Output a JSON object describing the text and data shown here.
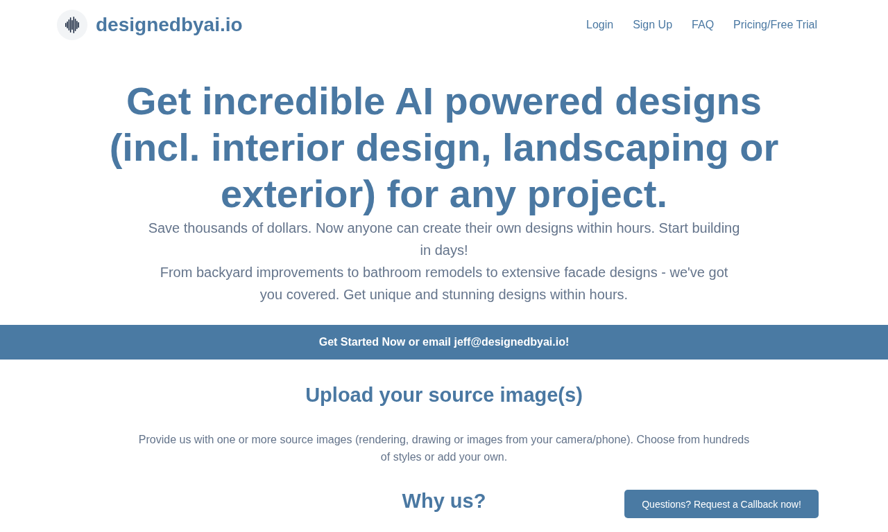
{
  "header": {
    "brand": "designedbyai.io",
    "nav": [
      "Login",
      "Sign Up",
      "FAQ",
      "Pricing/Free Trial"
    ]
  },
  "hero": {
    "title": "Get incredible AI powered designs (incl. interior design, landscaping or exterior) for any project.",
    "paragraphs": [
      "Save thousands of dollars. Now anyone can create their own designs within hours. Start building in days!",
      "From backyard improvements to bathroom remodels to extensive facade designs - we've got you covered. Get unique and stunning designs within hours."
    ]
  },
  "banner": {
    "text": "Get Started Now or email jeff@designedbyai.io!"
  },
  "sections": [
    {
      "heading": "Upload your source image(s)",
      "text": "Provide us with one or more source images (rendering, drawing or images from your camera/phone). Choose from hundreds of styles or add your own."
    },
    {
      "heading": "Why us?"
    }
  ],
  "callback_button": {
    "label": "Questions? Request a Callback now!"
  }
}
